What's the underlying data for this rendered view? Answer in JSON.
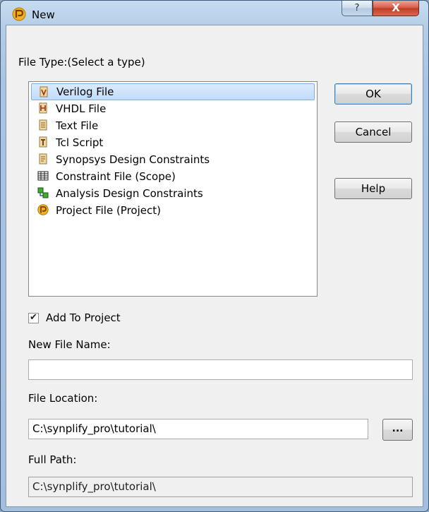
{
  "window": {
    "title": "New",
    "help_glyph": "?",
    "close_glyph": "X"
  },
  "file_type_label": "File Type:(Select a type)",
  "file_types": [
    {
      "label": "Verilog File",
      "icon": "verilog-file-icon",
      "selected": true
    },
    {
      "label": "VHDL File",
      "icon": "vhdl-file-icon",
      "selected": false
    },
    {
      "label": "Text File",
      "icon": "text-file-icon",
      "selected": false
    },
    {
      "label": "Tcl Script",
      "icon": "tcl-script-icon",
      "selected": false
    },
    {
      "label": "Synopsys Design Constraints",
      "icon": "constraints-file-icon",
      "selected": false
    },
    {
      "label": "Constraint File (Scope)",
      "icon": "scope-grid-icon",
      "selected": false
    },
    {
      "label": "Analysis Design Constraints",
      "icon": "analysis-constraints-icon",
      "selected": false
    },
    {
      "label": "Project File (Project)",
      "icon": "project-file-icon",
      "selected": false
    }
  ],
  "buttons": {
    "ok": "OK",
    "cancel": "Cancel",
    "help": "Help",
    "browse": "..."
  },
  "add_to_project": {
    "label": "Add To Project",
    "checked": true,
    "check_glyph": "✔"
  },
  "new_file_name": {
    "label": "New File Name:",
    "value": ""
  },
  "file_location": {
    "label": "File Location:",
    "value": "C:\\synplify_pro\\tutorial\\"
  },
  "full_path": {
    "label": "Full Path:",
    "value": "C:\\synplify_pro\\tutorial\\"
  },
  "colors": {
    "selection": "#c1dcfb",
    "close_button": "#c23b22",
    "frame": "#a9c4e2"
  }
}
